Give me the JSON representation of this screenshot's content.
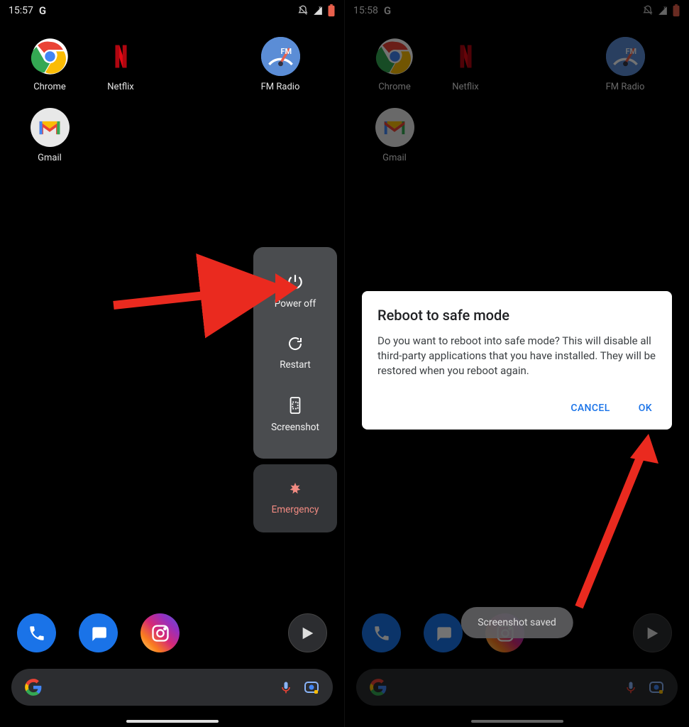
{
  "left": {
    "status": {
      "time": "15:57"
    },
    "apps": {
      "chrome": "Chrome",
      "netflix": "Netflix",
      "fmradio": "FM Radio",
      "gmail": "Gmail"
    },
    "power_menu": {
      "power_off": "Power off",
      "restart": "Restart",
      "screenshot": "Screenshot",
      "emergency": "Emergency"
    }
  },
  "right": {
    "status": {
      "time": "15:58"
    },
    "apps": {
      "chrome": "Chrome",
      "netflix": "Netflix",
      "fmradio": "FM Radio",
      "gmail": "Gmail"
    },
    "dialog": {
      "title": "Reboot to safe mode",
      "body": "Do you want to reboot into safe mode? This will disable all third-party applications that you have installed. They will be restored when you reboot again.",
      "cancel": "CANCEL",
      "ok": "OK"
    },
    "toast": "Screenshot saved"
  }
}
